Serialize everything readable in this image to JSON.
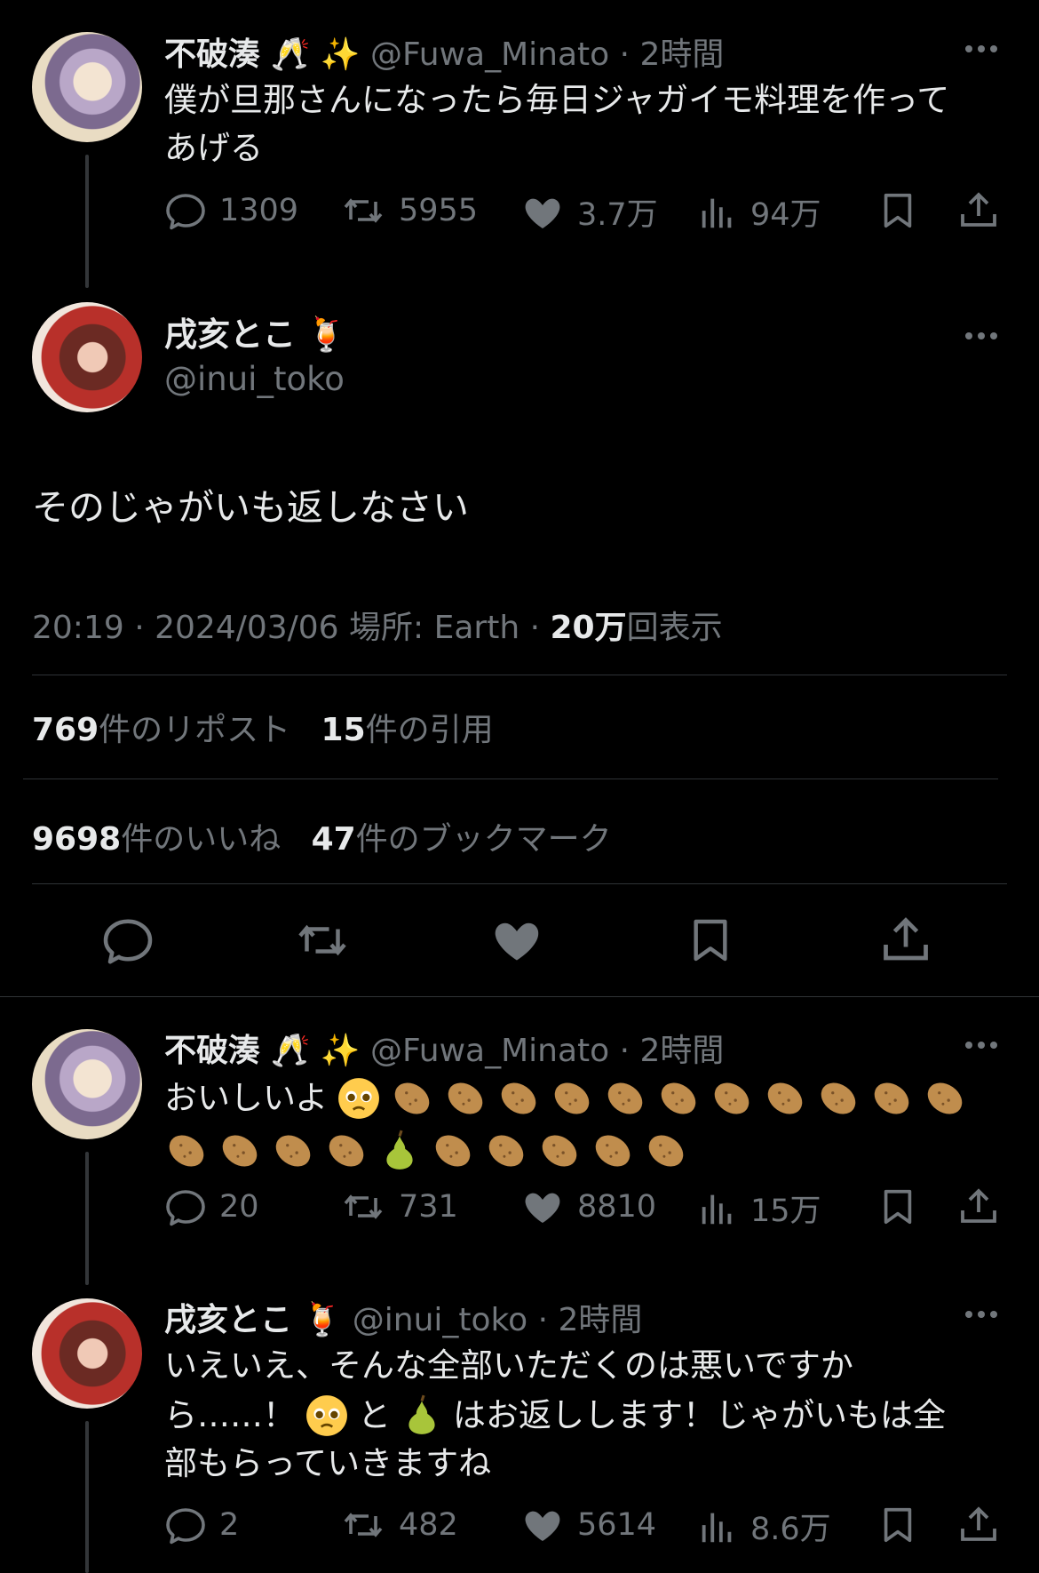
{
  "tweets": [
    {
      "name": "不破湊",
      "name_emoji": "🥂 ✨",
      "handle": "@Fuwa_Minato",
      "time": "· 2時間",
      "text1": "僕が旦那さんになったら毎日ジャガイモ料理を作って",
      "text2": "あげる",
      "replies": "1309",
      "reposts": "5955",
      "likes": "3.7万",
      "views": "94万"
    },
    {
      "name": "不破湊",
      "name_emoji": "🥂 ✨",
      "handle": "@Fuwa_Minato",
      "time": "· 2時間",
      "text_prefix": "おいしいよ",
      "replies": "20",
      "reposts": "731",
      "likes": "8810",
      "views": "15万"
    },
    {
      "name": "戌亥とこ",
      "name_emoji": "🍹",
      "handle": "@inui_toko",
      "time": "· 2時間",
      "text1": "いえいえ、そんな全部いただくのは悪いですか",
      "text2_a": "ら……！",
      "text2_b": "と",
      "text2_c": "はお返しします！じゃがいもは全",
      "text3": "部もらっていきますね",
      "replies": "2",
      "reposts": "482",
      "likes": "5614",
      "views": "8.6万"
    }
  ],
  "main_tweet": {
    "name": "戌亥とこ",
    "name_emoji": "🍹",
    "handle": "@inui_toko",
    "text": "そのじゃがいも返しなさい",
    "time": "20:19 · 2024/03/06",
    "location": "場所: Earth ·",
    "views_num": "20万",
    "views_label": "回表示",
    "reposts_num": "769",
    "reposts_label": "件のリポスト",
    "quotes_num": "15",
    "quotes_label": "件の引用",
    "likes_num": "9698",
    "likes_label": "件のいいね",
    "bookmarks_num": "47",
    "bookmarks_label": "件のブックマーク"
  },
  "colors": {
    "background": "#000000",
    "text": "#e7e9ea",
    "muted": "#71767b",
    "like": "#f91880",
    "divider": "#2f3336"
  },
  "icons": [
    "reply-icon",
    "repost-icon",
    "like-icon",
    "views-icon",
    "bookmark-icon",
    "share-icon",
    "more-icon"
  ]
}
